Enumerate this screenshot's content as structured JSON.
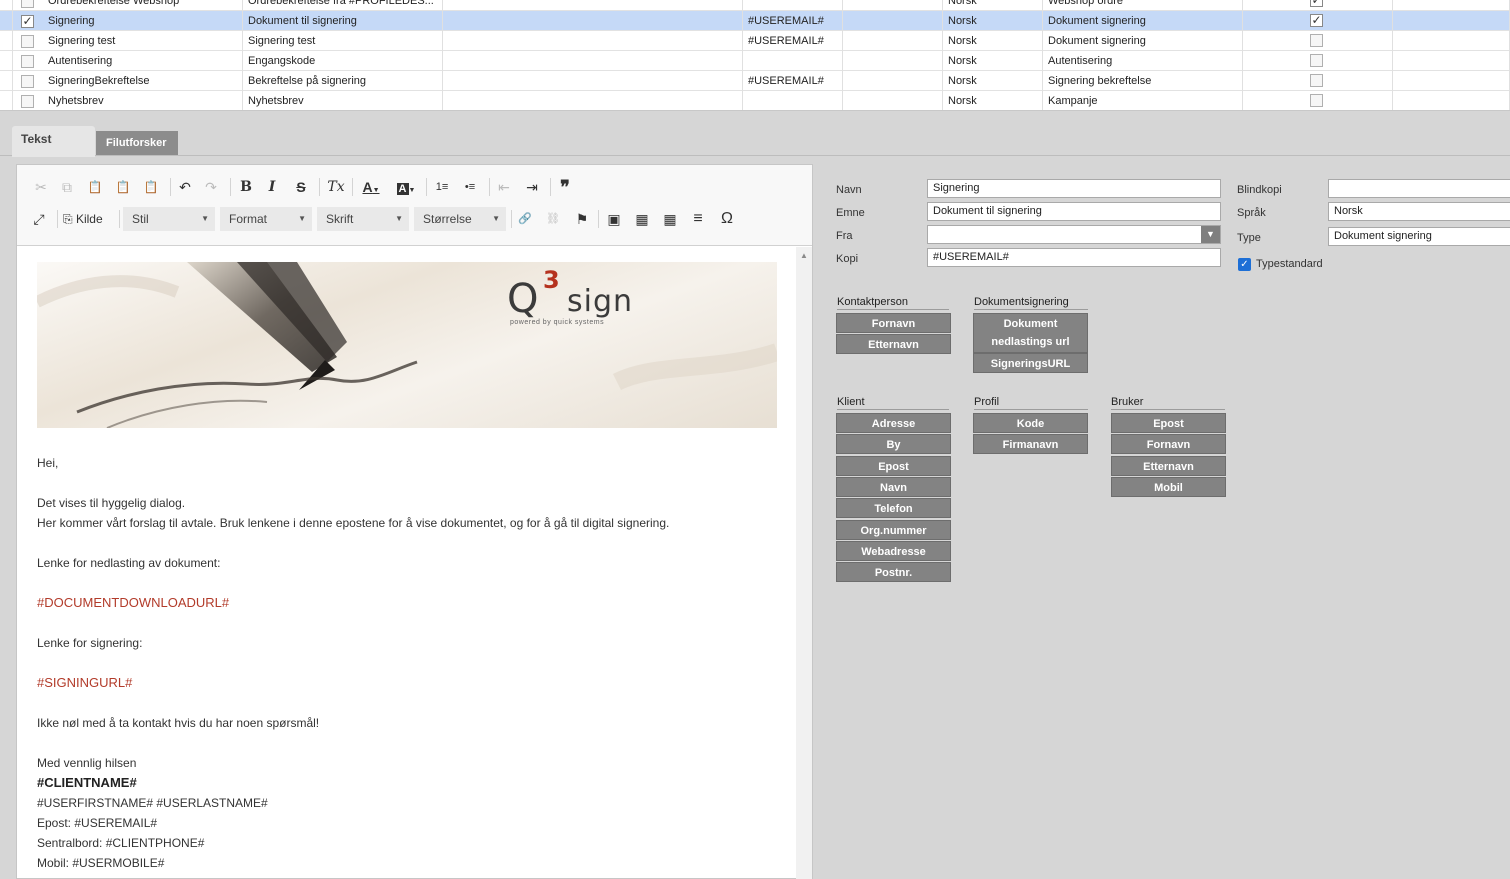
{
  "grid": {
    "rows": [
      {
        "name": "Ordrebekreftelse Webshop",
        "subject": "Ordrebekreftelse fra #PROFILEDES...",
        "kopi": "",
        "lang": "Norsk",
        "type": "Webshop ordre",
        "checked": false,
        "std": true
      },
      {
        "name": "Signering",
        "subject": "Dokument til signering",
        "kopi": "#USEREMAIL#",
        "lang": "Norsk",
        "type": "Dokument signering",
        "checked": true,
        "std": true
      },
      {
        "name": "Signering test",
        "subject": "Signering test",
        "kopi": "#USEREMAIL#",
        "lang": "Norsk",
        "type": "Dokument signering",
        "checked": false,
        "std": false
      },
      {
        "name": "Autentisering",
        "subject": "Engangskode",
        "kopi": "",
        "lang": "Norsk",
        "type": "Autentisering",
        "checked": false,
        "std": false
      },
      {
        "name": "SigneringBekreftelse",
        "subject": "Bekreftelse på signering",
        "kopi": "#USEREMAIL#",
        "lang": "Norsk",
        "type": "Signering bekreftelse",
        "checked": false,
        "std": false
      },
      {
        "name": "Nyhetsbrev",
        "subject": "Nyhetsbrev",
        "kopi": "",
        "lang": "Norsk",
        "type": "Kampanje",
        "checked": false,
        "std": false
      }
    ],
    "check_glyph": "✓"
  },
  "tabs": {
    "tekst": "Tekst",
    "filutforsker": "Filutforsker"
  },
  "toolbar": {
    "kilde": "Kilde",
    "stil": "Stil",
    "format": "Format",
    "skrift": "Skrift",
    "storrelse": "Størrelse",
    "glyphs": {
      "cut": "✂",
      "copy": "⧉",
      "paste": "📋",
      "undo": "↶",
      "redo": "↷",
      "bold": "B",
      "italic": "I",
      "strike": "S",
      "clear": "Tx",
      "color": "A",
      "bgcolor": "A",
      "ol": "1≡",
      "ul": "•≡",
      "outdent": "⇤",
      "indent": "⇥",
      "quote": "❞",
      "maximize": "⤢",
      "source": "⎘",
      "link": "🔗",
      "unlink": "⛓",
      "anchor": "⚑",
      "image": "▣",
      "flash": "▦",
      "table": "▦",
      "hr": "≡",
      "omega": "Ω",
      "caret": "▼"
    }
  },
  "content": {
    "banner": {
      "logo_q": "Q",
      "logo_3": "3",
      "logo_sign": "sign",
      "tagline": "powered by quick systems"
    },
    "greeting": "Hei,",
    "line1": "Det vises til hyggelig dialog.",
    "line2": "Her kommer vårt forslag til avtale.  Bruk lenkene i denne epostene for å vise dokumentet, og for å gå til digital signering.",
    "download_label": "Lenke for nedlasting av dokument:",
    "download_tag": "#DOCUMENTDOWNLOADURL#",
    "signing_label": "Lenke for signering:",
    "signing_tag": "#SIGNINGURL#",
    "contact": "Ikke nøl med å ta kontakt hvis du har noen spørsmål!",
    "regards": "Med vennlig hilsen",
    "client": "#CLIENTNAME#",
    "username": "#USERFIRSTNAME# #USERLASTNAME#",
    "email": "Epost: #USEREMAIL#",
    "phone": "Sentralbord: #CLIENTPHONE#",
    "mobile": "Mobil: #USERMOBILE#"
  },
  "form": {
    "navn_label": "Navn",
    "navn_value": "Signering",
    "emne_label": "Emne",
    "emne_value": "Dokument til signering",
    "fra_label": "Fra",
    "fra_value": "",
    "kopi_label": "Kopi",
    "kopi_value": "#USEREMAIL#",
    "blind_label": "Blindkopi",
    "blind_value": "",
    "sprak_label": "Språk",
    "sprak_value": "Norsk",
    "type_label": "Type",
    "type_value": "Dokument signering",
    "typestd_label": "Typestandard",
    "typestd_checked": true,
    "dd_glyph": "▼",
    "check_glyph": "✓"
  },
  "groups": {
    "kontaktperson": {
      "title": "Kontaktperson",
      "buttons": [
        "Fornavn",
        "Etternavn"
      ]
    },
    "dokumentsignering": {
      "title": "Dokumentsignering",
      "btn1_line1": "Dokument",
      "btn1_line2": "nedlastings url",
      "btn2": "SigneringsURL"
    },
    "klient": {
      "title": "Klient",
      "buttons": [
        "Adresse",
        "By",
        "Epost",
        "Navn",
        "Telefon",
        "Org.nummer",
        "Webadresse",
        "Postnr."
      ]
    },
    "profil": {
      "title": "Profil",
      "buttons": [
        "Kode",
        "Firmanavn"
      ]
    },
    "bruker": {
      "title": "Bruker",
      "buttons": [
        "Epost",
        "Fornavn",
        "Etternavn",
        "Mobil"
      ]
    }
  }
}
